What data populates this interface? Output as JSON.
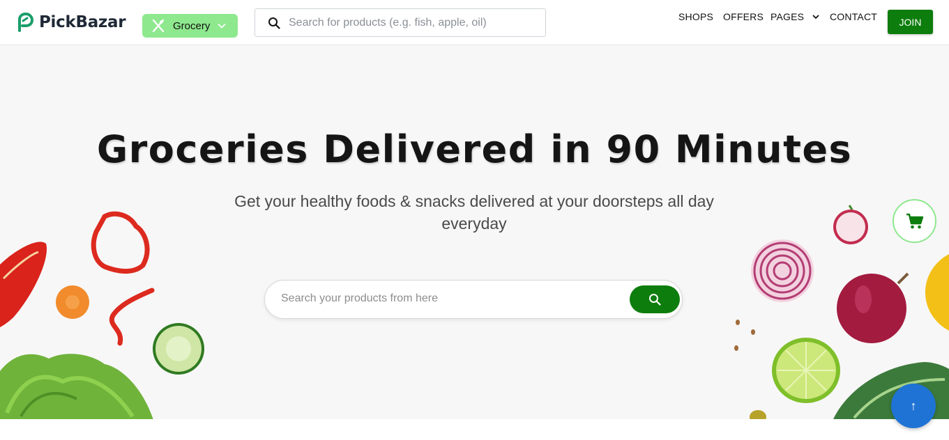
{
  "header": {
    "logo_text": "PickBazar",
    "category": {
      "label": "Grocery",
      "icon": "fork-knife-icon"
    },
    "search": {
      "placeholder": "Search for products (e.g. fish, apple, oil)",
      "value": ""
    },
    "nav": {
      "shops": "SHOPS",
      "offers": "OFFERS",
      "pages": "PAGES",
      "contact": "CONTACT"
    },
    "join_label": "JOIN"
  },
  "hero": {
    "title": "Groceries Delivered in 90 Minutes",
    "subtitle": "Get your healthy foods & snacks delivered at your doorsteps all day everyday",
    "search": {
      "placeholder": "Search your products from here",
      "value": ""
    }
  },
  "floating": {
    "cart_icon": "cart-icon",
    "scroll_top_label": "↑"
  },
  "colors": {
    "brand_green": "#0d7d0d",
    "category_green": "#8ee88e",
    "scroll_top_blue": "#1f73d4",
    "hero_bg": "#f7f7f7"
  }
}
